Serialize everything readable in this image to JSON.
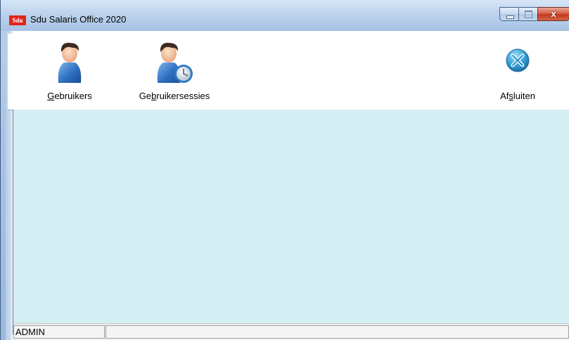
{
  "window": {
    "logo_text": "Sdu",
    "title": "Sdu Salaris Office 2020",
    "close_glyph": "x"
  },
  "toolbar": {
    "users": {
      "label_underlined": "G",
      "label_rest": "ebruikers",
      "icon": "user-icon"
    },
    "sessions": {
      "label_pre": "Ge",
      "label_underlined": "b",
      "label_rest": "ruikersessies",
      "icon": "user-clock-icon"
    },
    "exit": {
      "label_pre": "Af",
      "label_underlined": "s",
      "label_rest": "luiten",
      "icon": "close-circle-icon"
    }
  },
  "statusbar": {
    "user": "ADMIN",
    "message": ""
  },
  "colors": {
    "content_bg": "#d5eef3",
    "logo_red": "#e2231a",
    "exit_blue": "#3aa6d8"
  }
}
